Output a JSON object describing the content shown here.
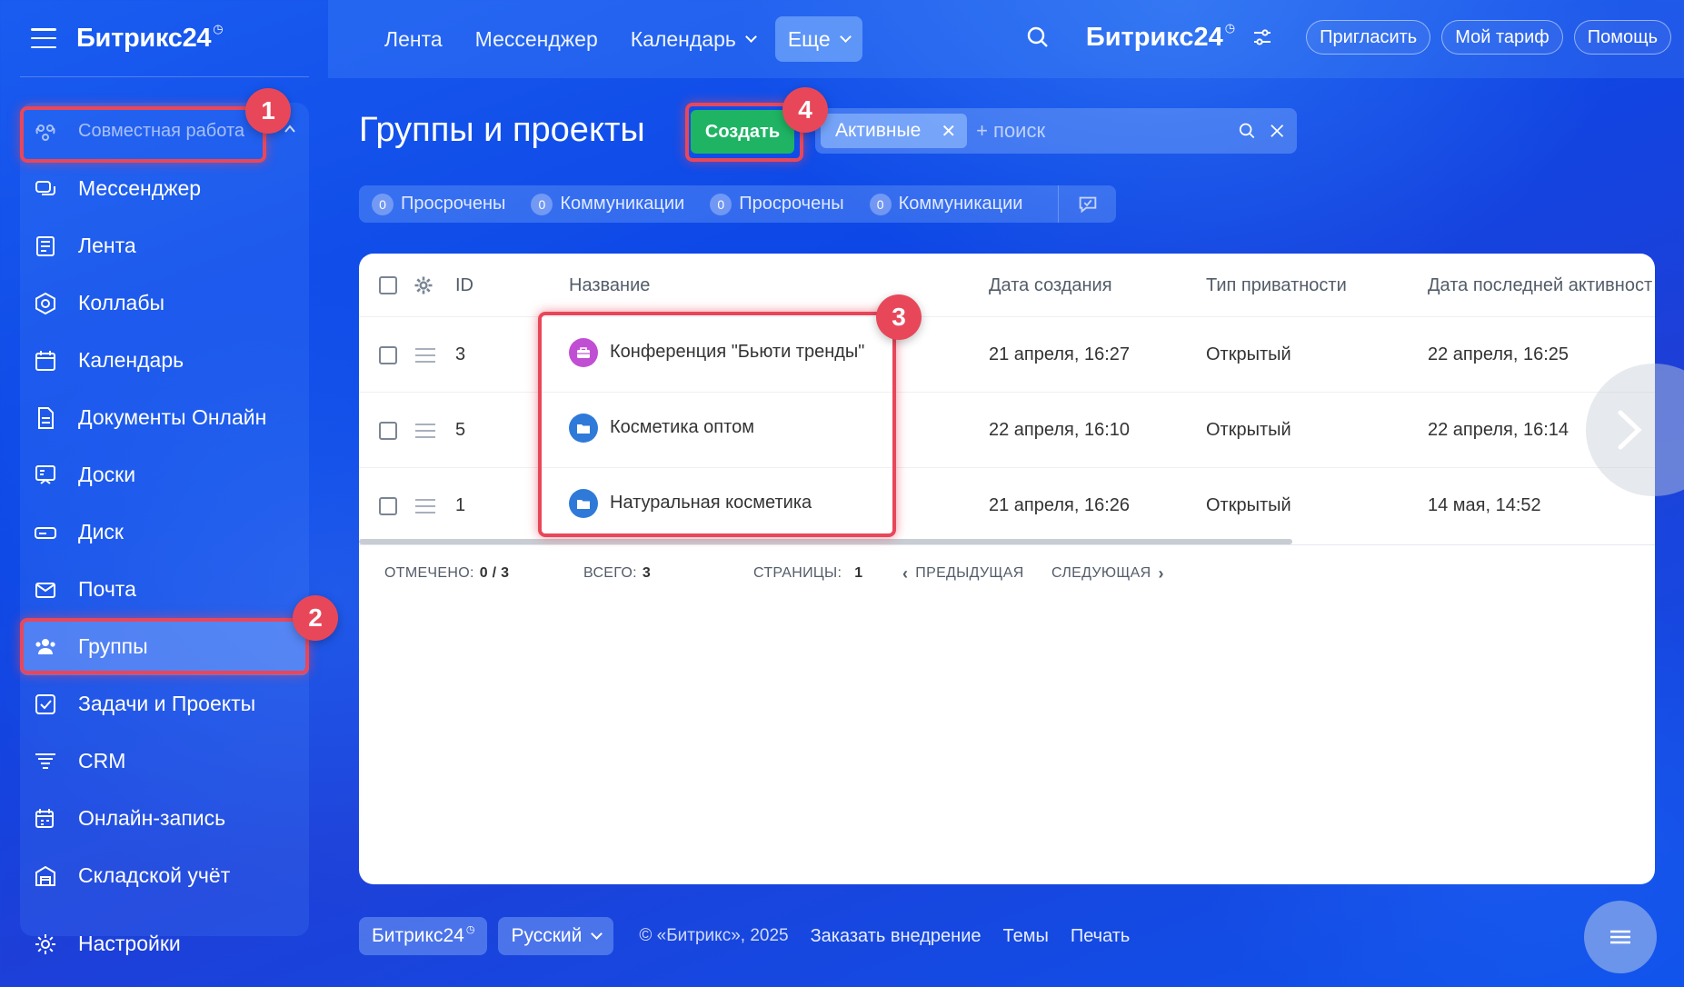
{
  "sidebar": {
    "logo": "Битрикс24",
    "logo_mark": "◷",
    "section_label": "Совместная работа",
    "items": [
      {
        "label": "Мессенджер"
      },
      {
        "label": "Лента"
      },
      {
        "label": "Коллабы"
      },
      {
        "label": "Календарь"
      },
      {
        "label": "Документы Онлайн"
      },
      {
        "label": "Доски"
      },
      {
        "label": "Диск"
      },
      {
        "label": "Почта"
      },
      {
        "label": "Группы"
      },
      {
        "label": "Задачи и Проекты"
      },
      {
        "label": "CRM"
      },
      {
        "label": "Онлайн-запись"
      },
      {
        "label": "Складской учёт"
      }
    ],
    "settings_label": "Настройки"
  },
  "topbar": {
    "nav": [
      "Лента",
      "Мессенджер",
      "Календарь",
      "Еще"
    ],
    "logo": "Битрикс24",
    "logo_mark": "◷",
    "invite": "Пригласить",
    "tariff": "Мой тариф",
    "help": "Помощь"
  },
  "main": {
    "title": "Группы и проекты",
    "create_label": "Создать",
    "filter": {
      "chip": "Активные",
      "placeholder": "+ поиск"
    },
    "counters": [
      {
        "count": "0",
        "label": "Просрочены"
      },
      {
        "count": "0",
        "label": "Коммуникации"
      },
      {
        "count": "0",
        "label": "Просрочены"
      },
      {
        "count": "0",
        "label": "Коммуникации"
      }
    ],
    "grid": {
      "columns": [
        "ID",
        "Название",
        "Дата создания",
        "Тип приватности",
        "Дата последней активност"
      ],
      "rows": [
        {
          "id": "3",
          "name": "Конференция \"Бьюти тренды\"",
          "created": "21 апреля, 16:27",
          "privacy": "Открытый",
          "last_activity": "22 апреля, 16:25",
          "icon": "briefcase-icon"
        },
        {
          "id": "5",
          "name": "Косметика оптом",
          "created": "22 апреля, 16:10",
          "privacy": "Открытый",
          "last_activity": "22 апреля, 16:14",
          "icon": "folder-icon"
        },
        {
          "id": "1",
          "name": "Натуральная косметика",
          "created": "21 апреля, 16:26",
          "privacy": "Открытый",
          "last_activity": "14 мая, 14:52",
          "icon": "folder-icon"
        }
      ],
      "footer": {
        "checked_label": "ОТМЕЧЕНО:",
        "checked_value": "0 / 3",
        "total_label": "ВСЕГО:",
        "total_value": "3",
        "pages_label": "СТРАНИЦЫ:",
        "pages_value": "1",
        "prev": "ПРЕДЫДУЩАЯ",
        "next": "СЛЕДУЮЩАЯ"
      }
    }
  },
  "annotations": [
    "1",
    "2",
    "3",
    "4"
  ],
  "footer": {
    "brand": "Битрикс24",
    "brand_mark": "◷",
    "language": "Русский",
    "copyright": "© «Битрикс», 2025",
    "links": [
      "Заказать внедрение",
      "Темы",
      "Печать"
    ]
  },
  "colors": {
    "accent_green": "#1fb464",
    "highlight_red": "#e8475a",
    "group_purple": "#c14fd3",
    "group_blue": "#2f7ad9"
  }
}
